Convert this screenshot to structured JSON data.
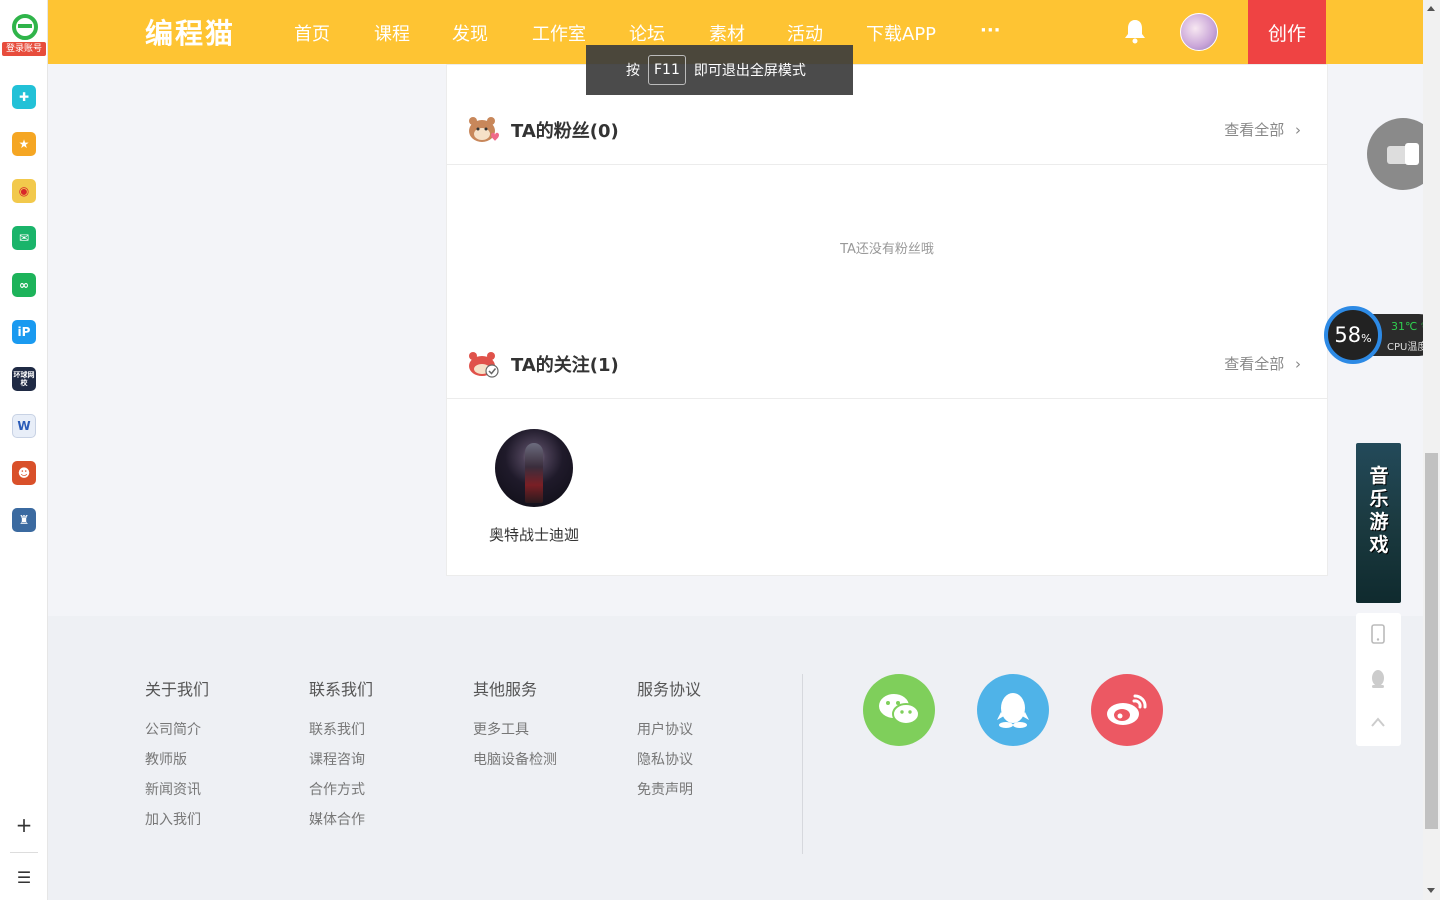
{
  "sidebar": {
    "login_label": "登录账号",
    "apps": [
      {
        "name": "plus-cross-app",
        "color": "#22c1d7"
      },
      {
        "name": "star-app",
        "color": "#f5a623"
      },
      {
        "name": "weibo-app",
        "color": "#f2c94c"
      },
      {
        "name": "mail-app",
        "color": "#1ab46a"
      },
      {
        "name": "link-app",
        "color": "#1db35a"
      },
      {
        "name": "ip-app",
        "color": "#1a9af0"
      },
      {
        "name": "news-app",
        "color": "#1f2a44"
      },
      {
        "name": "word-app",
        "color": "#e8eef8"
      },
      {
        "name": "game-app-1",
        "color": "#d9502a"
      },
      {
        "name": "game-app-2",
        "color": "#3b6aa0"
      }
    ],
    "news_app_label": "环球网校"
  },
  "navbar": {
    "brand": "编程猫",
    "items": [
      "首页",
      "课程",
      "发现",
      "工作室",
      "论坛",
      "素材",
      "活动",
      "下载APP",
      "···"
    ],
    "create_label": "创作",
    "bg_color": "#fec433",
    "create_color": "#ef4343"
  },
  "toast": {
    "prefix": "按",
    "key": "F11",
    "suffix": "即可退出全屏模式"
  },
  "fans": {
    "title": "TA的粉丝(0)",
    "view_all": "查看全部",
    "empty_text": "TA还没有粉丝哦"
  },
  "following": {
    "title": "TA的关注(1)",
    "view_all": "查看全部",
    "users": [
      {
        "name": "奥特战士迪迦"
      }
    ]
  },
  "footer": {
    "columns": [
      {
        "heading": "关于我们",
        "links": [
          "公司简介",
          "教师版",
          "新闻资讯",
          "加入我们"
        ]
      },
      {
        "heading": "联系我们",
        "links": [
          "联系我们",
          "课程咨询",
          "合作方式",
          "媒体合作"
        ]
      },
      {
        "heading": "其他服务",
        "links": [
          "更多工具",
          "电脑设备检测"
        ]
      },
      {
        "heading": "服务协议",
        "links": [
          "用户协议",
          "隐私协议",
          "免责声明"
        ]
      }
    ],
    "social": [
      {
        "name": "wechat-icon",
        "color": "#7fcf5b"
      },
      {
        "name": "qq-icon",
        "color": "#4fb3e8"
      },
      {
        "name": "weibo-icon",
        "color": "#ec5863"
      }
    ]
  },
  "widgets": {
    "cpu_usage": "58",
    "cpu_unit": "%",
    "cpu_temp": "31℃",
    "cpu_label": "CPU温度",
    "ad_text": "音乐游戏"
  }
}
